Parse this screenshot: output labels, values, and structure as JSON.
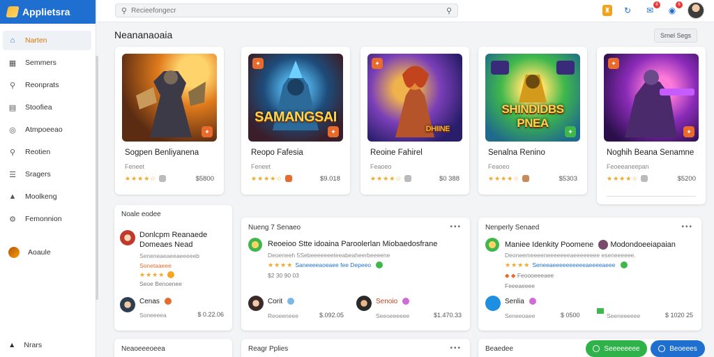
{
  "app": {
    "title": "Applietsra"
  },
  "sidebar": {
    "items": [
      {
        "label": "Narten",
        "icon": "home-icon",
        "active": true
      },
      {
        "label": "Semmers",
        "icon": "grid-icon"
      },
      {
        "label": "Reonprats",
        "icon": "user-icon"
      },
      {
        "label": "Stoofiea",
        "icon": "calendar-icon"
      },
      {
        "label": "Atmpoeeao",
        "icon": "compass-icon"
      },
      {
        "label": "Reotien",
        "icon": "search-icon"
      },
      {
        "label": "Sragers",
        "icon": "list-icon"
      },
      {
        "label": "Moolkeng",
        "icon": "chart-icon"
      },
      {
        "label": "Femonnion",
        "icon": "settings-icon"
      },
      {
        "label": "Aoaule",
        "icon": "avatar"
      }
    ],
    "bottom_label": "Nrars"
  },
  "header": {
    "search_placeholder": "Recieefongecr",
    "notif_count": "6",
    "msg_count": "8"
  },
  "page": {
    "title": "Neananaoaia",
    "action_label": "Srnel Segs"
  },
  "games": [
    {
      "title": "Sogpen Benliyanena",
      "sub": "Feneet",
      "stars": "★★★★☆",
      "price": "$5800",
      "art_text": ""
    },
    {
      "title": "Reopo Fafesia",
      "sub": "Feneet",
      "stars": "★★★★☆",
      "price": "$9.018",
      "art_text": "SAMANGSAI"
    },
    {
      "title": "Reoine Fahirel",
      "sub": "Feaoeo",
      "stars": "★★★★☆",
      "price": "$0 388",
      "art_text": "DHIINE"
    },
    {
      "title": "Senalna Renino",
      "sub": "Feaoeo",
      "stars": "★★★★☆",
      "price": "$5303",
      "art_text": "SHINDIDBS PNEA"
    },
    {
      "title": "Noghih Beana Senamne",
      "sub": "Feoeeaneepan",
      "stars": "★★★★☆",
      "price": "$5200",
      "art_text": ""
    }
  ],
  "panel_left": {
    "title": "Noale eodee",
    "item_title_1": "Donlcpm Reanaede",
    "item_title_2": "Domeaes Nead",
    "item_desc": "Seneneaeaeeaeeeeeb",
    "item_tag": "Sonetaaeee",
    "item_stars": "★★★★",
    "item_meta": "Seoe Benoenee",
    "user_name": "Cenas",
    "user_sub": "Soneeeea",
    "user_price": "$ 0.22.06"
  },
  "panel_mid": {
    "title": "Nueng 7 Senaeo",
    "heading": "Reoeioo Stte idoaina Paroolerlan Miobaedosfrane",
    "desc": "Deoeneeh 5Sebeeeeeeeteeabeaheerbeeeene",
    "tag_line": "Saneeeeaoeaee fee Depeeo",
    "price_line": "$2 30 90 03",
    "user1_name": "Corit",
    "user1_sub": "Reoeeneee",
    "user1_price": "$.092.05",
    "user2_name": "Senoio",
    "user2_sub": "Seeoeeeeee",
    "user2_price": "$1.470.33"
  },
  "panel_right": {
    "title": "Nenperly Senaed",
    "heading_a": "Maniee Idenkity Poomene",
    "heading_b": "Modondoeeiapaian",
    "desc": "Deoneemeeeeneeeeeeeaeeeeeeee eseneeeeee.",
    "tag_line": "Seneeaeeeeeeeeeeaeeeeaeee",
    "meta_1": "Feoooeeeaee",
    "meta_2": "Feeeaeeee",
    "user_name": "Senlia",
    "user_sub": "Seneeoaee",
    "user_price": "$ 0500",
    "user2_sub": "Seeneeeeee",
    "user2_price": "$ 1020 25"
  },
  "bottom_row": {
    "left": "Neaoeeeoeea",
    "mid": "Reagr Pplies",
    "right": "Beaedee"
  },
  "buttons": {
    "green": "Seeeeeeee",
    "blue": "Beoeees"
  }
}
